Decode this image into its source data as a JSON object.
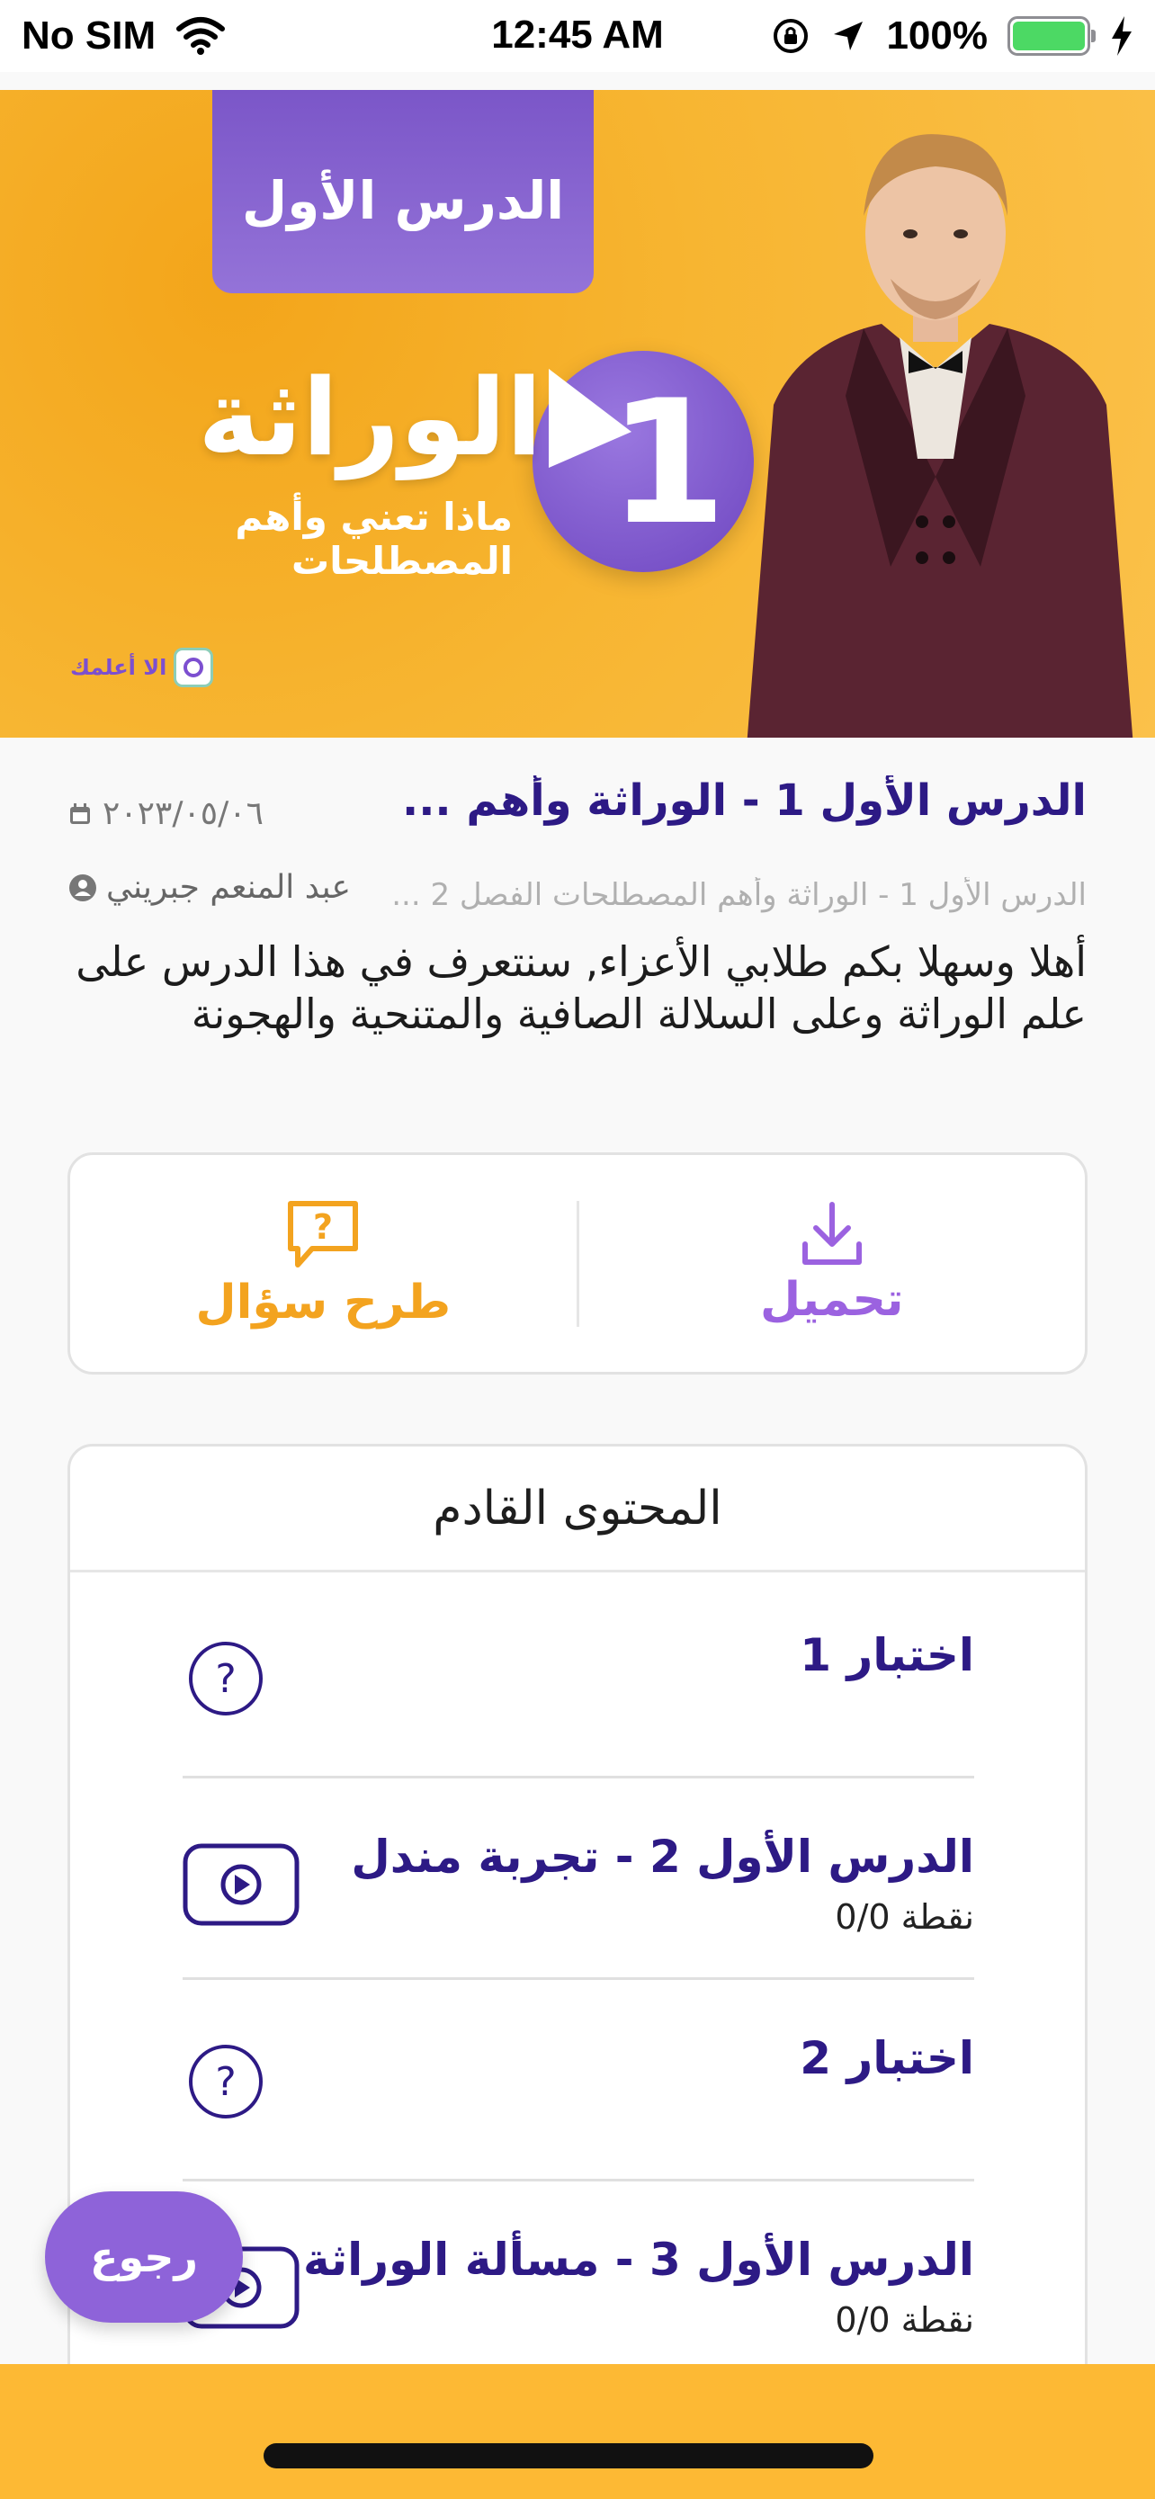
{
  "status_bar": {
    "carrier": "No SIM",
    "time": "12:45 AM",
    "battery": "100%"
  },
  "banner": {
    "tab_label": "الدرس الأول",
    "title": "الوراثة",
    "subtitle": "ماذا تعني وأهم المصطلحات",
    "logo_text": "الا أعلمك",
    "lesson_number": "1"
  },
  "lesson": {
    "title": "الدرس الأول 1 - الوراثة وأهم ...",
    "date": "٢٠٢٣/٠٥/٠٦",
    "breadcrumb": "الدرس الأول 1 - الوراثة وأهم المصطلحات الفصل 2 ...",
    "author": "عبد المنعم جبريني",
    "description": "أهلا وسهلا بكم طلابي الأعزاء, سنتعرف في هذا الدرس على علم الوراثة وعلى السلالة الصافية والمتنحية والهجونة"
  },
  "actions": {
    "download_label": "تحميل",
    "ask_label": "طرح سؤال"
  },
  "upcoming": {
    "header": "المحتوى القادم",
    "items": [
      {
        "title": "اختبار 1",
        "points": "",
        "type": "question-icon"
      },
      {
        "title": "الدرس الأول 2 - تجربة مندل",
        "points": "0/0 نقطة",
        "type": "video-icon"
      },
      {
        "title": "اختبار 2",
        "points": "",
        "type": "question-icon"
      },
      {
        "title": "الدرس الأول 3 - مسألة الوراثة",
        "points": "0/0 نقطة",
        "type": "video-icon"
      }
    ]
  },
  "back_button": {
    "label": "رجوع"
  },
  "colors": {
    "primary_purple": "#2d1a85",
    "accent_purple": "#8e63d9",
    "accent_orange": "#f3a31f",
    "banner_yellow": "#f7b531"
  }
}
